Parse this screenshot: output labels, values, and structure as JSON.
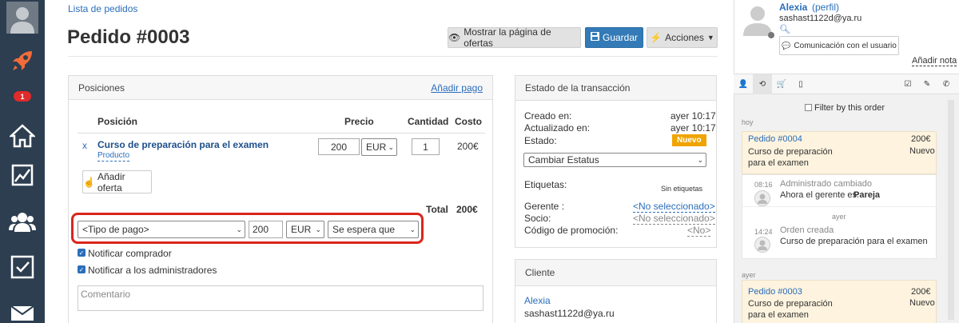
{
  "sidebar": {
    "badge": "1",
    "items": [
      "user-icon",
      "rocket-icon",
      "home-icon",
      "chart-icon",
      "users-icon",
      "checkbox-icon",
      "mail-icon"
    ]
  },
  "breadcrumb": "Lista de pedidos",
  "title": "Pedido #0003",
  "toolbar": {
    "show_offers": "Mostrar la página de ofertas",
    "save": "Guardar",
    "actions": "Acciones"
  },
  "positions": {
    "header": "Posiciones",
    "add_payment": "Añadir pago",
    "columns": {
      "position": "Posición",
      "price": "Precio",
      "quantity": "Cantidad",
      "cost": "Costo"
    },
    "row": {
      "remove": "x",
      "name": "Curso de preparación para el examen",
      "type": "Producto",
      "price": "200",
      "currency": "EUR",
      "quantity": "1",
      "cost": "200€"
    },
    "add_offer": "Añadir oferta",
    "total_label": "Total",
    "total_value": "200€",
    "payment": {
      "type": "<Tipo de pago>",
      "amount": "200",
      "currency": "EUR",
      "status": "Se espera que"
    },
    "notify_buyer": "Notificar comprador",
    "notify_admins": "Notificar a los administradores",
    "comment_placeholder": "Comentario"
  },
  "transaction": {
    "header": "Estado de la transacción",
    "created_label": "Creado en:",
    "created_value": "ayer 10:17",
    "updated_label": "Actualizado en:",
    "updated_value": "ayer 10:17",
    "status_label": "Estado:",
    "status_badge": "Nuevo",
    "change_status": "Cambiar Estatus",
    "tags_label": "Etiquetas:",
    "tags_value": "Sin etiquetas",
    "manager_label": "Gerente :",
    "manager_value": "<No seleccionado>",
    "partner_label": "Socio:",
    "partner_value": "<No seleccionado>",
    "promo_label": "Código de promoción:",
    "promo_value": "<No>"
  },
  "client": {
    "header": "Cliente",
    "name": "Alexia",
    "email": "sashast1122d@ya.ru"
  },
  "profile": {
    "name": "Alexia",
    "profile_link": "(perfil)",
    "email": "sashast1122d@ya.ru",
    "contact_button": "Comunicación con el usuario",
    "add_note": "Añadir nota"
  },
  "filter_label": "Filter by this order",
  "feed": {
    "today": "hoy",
    "order1": {
      "title": "Pedido #0004",
      "amount": "200€",
      "desc": "Curso de preparación para el examen",
      "status": "Nuevo"
    },
    "event1": {
      "time": "08:16",
      "title": "Administrado cambiado",
      "text": "Ahora el gerente es:",
      "bold": "Pareja"
    },
    "yesterday_inner": "ayer",
    "event2": {
      "time": "14:24",
      "title": "Orden creada",
      "text": "Curso de preparación para el examen"
    },
    "yesterday": "ayer",
    "order2": {
      "title": "Pedido #0003",
      "amount": "200€",
      "desc": "Curso de preparación para el examen",
      "status": "Nuevo"
    }
  },
  "colors": {
    "sidebar": "#2d3e50",
    "accent": "#2a6ebb",
    "save": "#337ab7",
    "badge": "#f0a400",
    "highlight": "#d9261c",
    "rocket": "#f26b3a"
  }
}
